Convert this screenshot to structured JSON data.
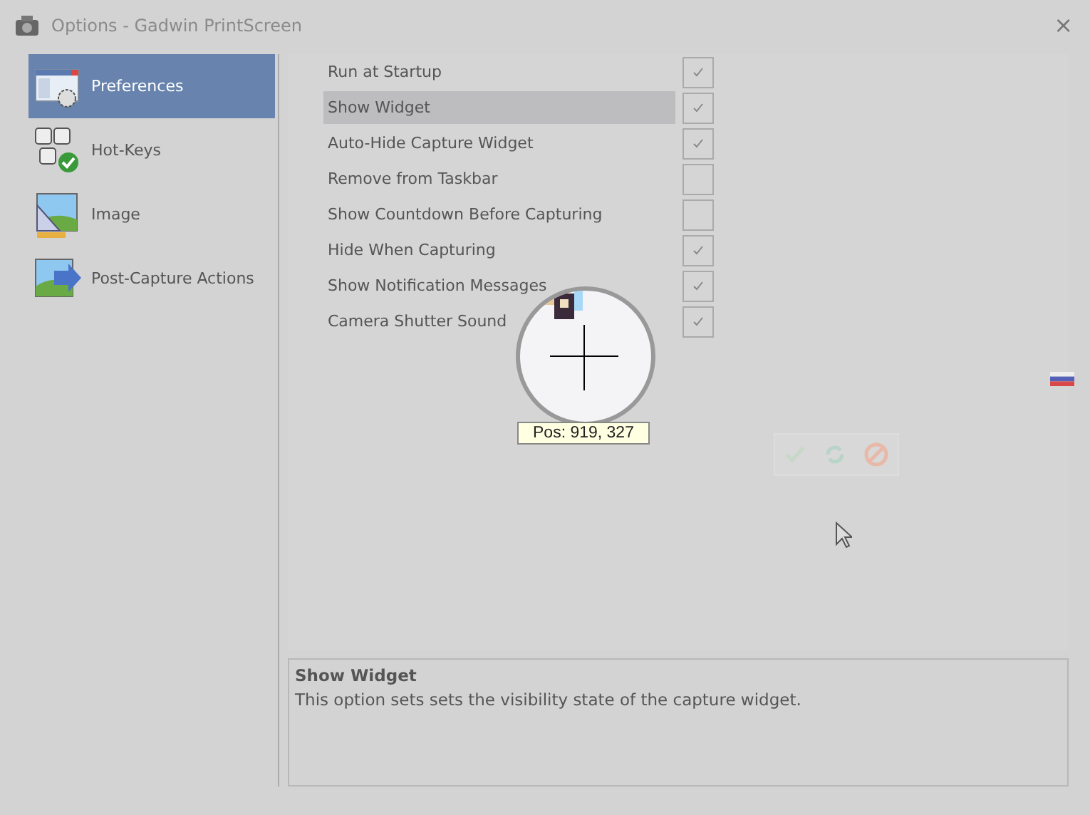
{
  "window": {
    "title": "Options - Gadwin PrintScreen",
    "close": "×"
  },
  "sidebar": {
    "items": [
      {
        "label": "Preferences",
        "kind": "preferences",
        "selected": true
      },
      {
        "label": "Hot-Keys",
        "kind": "hotkeys",
        "selected": false
      },
      {
        "label": "Image",
        "kind": "image",
        "selected": false
      },
      {
        "label": "Post-Capture Actions",
        "kind": "actions",
        "selected": false
      }
    ]
  },
  "options": [
    {
      "label": "Run at Startup",
      "checked": true,
      "selected": false
    },
    {
      "label": "Show Widget",
      "checked": true,
      "selected": true
    },
    {
      "label": "Auto-Hide Capture Widget",
      "checked": true,
      "selected": false
    },
    {
      "label": "Remove from Taskbar",
      "checked": false,
      "selected": false
    },
    {
      "label": "Show Countdown Before Capturing",
      "checked": false,
      "selected": false
    },
    {
      "label": "Hide When Capturing",
      "checked": true,
      "selected": false
    },
    {
      "label": "Show Notification Messages",
      "checked": true,
      "selected": false
    },
    {
      "label": "Camera Shutter Sound",
      "checked": true,
      "selected": false
    }
  ],
  "magnifier": {
    "position": "Pos: 919, 327"
  },
  "description": {
    "title": "Show Widget",
    "text": "This option sets sets the visibility state of the capture widget."
  }
}
